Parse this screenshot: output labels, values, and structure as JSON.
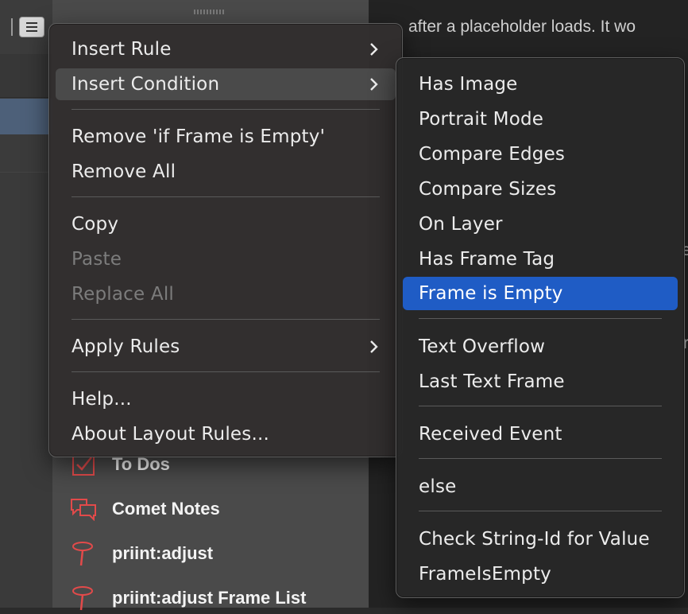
{
  "toolbar": {
    "view_icon": "list-icon"
  },
  "panel": {
    "items": [
      {
        "label": "To Dos",
        "icon": "checkbox-icon"
      },
      {
        "label": "Comet Notes",
        "icon": "speech-bubbles-icon"
      },
      {
        "label": "priint:adjust",
        "icon": "pin-icon"
      },
      {
        "label": "priint:adjust Frame List",
        "icon": "pin-icon"
      }
    ]
  },
  "document": {
    "text_line": "after a placeholder loads. It wo",
    "fragment_e": "e",
    "fragment_bar": "r"
  },
  "context_menu": {
    "insert_rule": "Insert Rule",
    "insert_condition": "Insert Condition",
    "remove_if": "Remove 'if Frame is Empty'",
    "remove_all": "Remove All",
    "copy": "Copy",
    "paste": "Paste",
    "replace_all": "Replace All",
    "apply_rules": "Apply Rules",
    "help": "Help...",
    "about": "About Layout Rules..."
  },
  "submenu": {
    "items": [
      "Has Image",
      "Portrait Mode",
      "Compare Edges",
      "Compare Sizes",
      "On Layer",
      "Has Frame Tag",
      "Frame is Empty",
      "Text Overflow",
      "Last Text Frame",
      "Received Event",
      "else",
      "Check String-Id for Value",
      "FrameIsEmpty"
    ],
    "selected": "Frame is Empty"
  },
  "colors": {
    "selection_blue": "#1f5cc5",
    "icon_red": "#e24a4a"
  }
}
